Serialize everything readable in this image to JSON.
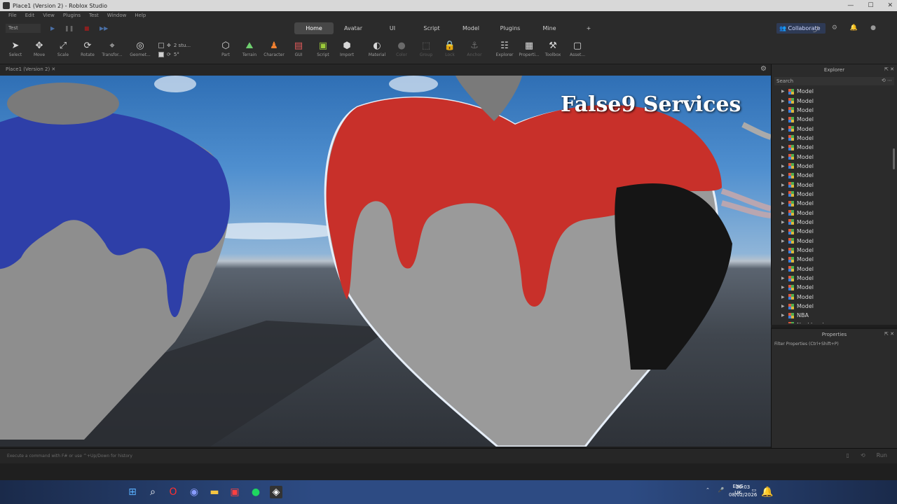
{
  "window": {
    "title": "Place1 (Version 2) - Roblox Studio",
    "controls": [
      "—",
      "☐",
      "✕"
    ]
  },
  "menu": [
    "File",
    "Edit",
    "View",
    "Plugins",
    "Test",
    "Window",
    "Help"
  ],
  "test_mode": "Test",
  "tabs": [
    "Home",
    "Avatar",
    "UI",
    "Script",
    "Model",
    "Plugins",
    "Mine",
    "+"
  ],
  "active_tab": "Home",
  "collaborate_label": "Collaborate",
  "toolbar": {
    "select": "Select",
    "move": "Move",
    "scale": "Scale",
    "rotate": "Rotate",
    "transform": "Transfor...",
    "geometry": "Geomet...",
    "snap_move": "2 stu...",
    "snap_rotate": "5°",
    "part": "Part",
    "terrain": "Terrain",
    "character": "Character",
    "gui": "GUI",
    "script": "Script",
    "import": "Import",
    "material": "Material",
    "color": "Color",
    "group": "Group",
    "lock": "Lock",
    "anchor": "Anchor",
    "explorer": "Explorer",
    "properties": "Properti...",
    "toolbox": "Toolbox",
    "asset": "Asset..."
  },
  "document_tab": "Place1 (Version 2)",
  "viewport": {
    "watermark": "False9 Services"
  },
  "explorer": {
    "title": "Explorer",
    "search_placeholder": "Search",
    "items": [
      "Model",
      "Model",
      "Model",
      "Model",
      "Model",
      "Model",
      "Model",
      "Model",
      "Model",
      "Model",
      "Model",
      "Model",
      "Model",
      "Model",
      "Model",
      "Model",
      "Model",
      "Model",
      "Model",
      "Model",
      "Model",
      "Model",
      "Model",
      "Model",
      "NBA",
      "Necklacej"
    ]
  },
  "properties": {
    "title": "Properties",
    "filter_placeholder": "Filter Properties (Ctrl+Shift+P)"
  },
  "command_bar": {
    "placeholder": "Execute a command with F# or use ^+Up/Down for history",
    "right_label": "Run"
  },
  "taskbar": {
    "lang": "ENG",
    "region": "UK",
    "time": "20:03",
    "date": "08/02/2026"
  },
  "colors": {
    "heart_red": "#c8302a",
    "heart_blue": "#2e3fa8",
    "accent_blue": "#2e3a55"
  }
}
